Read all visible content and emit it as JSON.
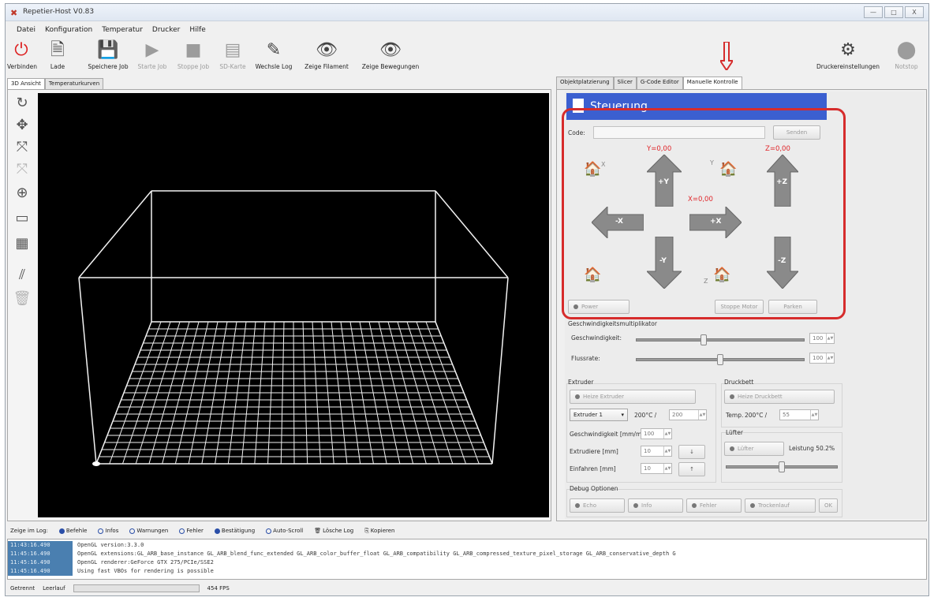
{
  "window": {
    "title": "Repetier-Host V0.83",
    "minimize": "—",
    "maximize": "□",
    "close": "X"
  },
  "menu": [
    "Datei",
    "Konfiguration",
    "Temperatur",
    "Drucker",
    "Hilfe"
  ],
  "toolbar": {
    "connect": "Verbinden",
    "load": "Lade",
    "save_job": "Speichere Job",
    "start_job": "Starte Job",
    "stop_job": "Stoppe Job",
    "sd_card": "SD-Karte",
    "toggle_log": "Wechsle Log",
    "show_filament": "Zeige Filament",
    "show_travel": "Zeige Bewegungen",
    "printer_settings": "Druckereinstellungen",
    "emergency_stop": "Notstop"
  },
  "left_tabs": [
    "3D Ansicht",
    "Temperaturkurven"
  ],
  "right_tabs": [
    "Objektplatzierung",
    "Slicer",
    "G-Code Editor",
    "Manuelle Kontrolle"
  ],
  "manual": {
    "header": "Steuerung",
    "code_label": "Code:",
    "code_value": "",
    "send": "Senden",
    "y_pos": "Y=0,00",
    "z_pos": "Z=0,00",
    "x_pos": "X=0,00",
    "plus_y": "+Y",
    "minus_y": "-Y",
    "plus_x": "+X",
    "minus_x": "-X",
    "plus_z": "+Z",
    "minus_z": "-Z",
    "axis_x": "X",
    "axis_y": "Y",
    "axis_z": "Z",
    "power": "Power",
    "stop_motor": "Stoppe Motor",
    "park": "Parken"
  },
  "speed": {
    "title": "Geschwindigkeitsmultiplikator",
    "speed_label": "Geschwindigkeit:",
    "speed_value": "100",
    "speed_level": 0.4,
    "flow_label": "Fluss­rate:",
    "flow_value": "100",
    "flow_level": 0.5
  },
  "extruder": {
    "title": "Extruder",
    "heat": "Heize Extruder",
    "select": "Extruder 1",
    "temp_text": "200°C /",
    "temp_target": "200",
    "speed_label": "Geschwindigkeit [mm/min]",
    "speed_value": "100",
    "extrude_label": "Extrudiere [mm]",
    "extrude_value": "10",
    "retract_label": "Einfahren [mm]",
    "retract_value": "10"
  },
  "bed": {
    "title": "Druckbett",
    "heat": "Heize Druckbett",
    "temp_label": "Temp.",
    "temp_text": "200°C /",
    "temp_target": "55"
  },
  "fan": {
    "title": "Lüfter",
    "button": "Lüfter",
    "power": "Leistung 50.2%",
    "level": 0.5
  },
  "debug": {
    "title": "Debug Optionen",
    "echo": "Echo",
    "info": "Info",
    "error": "Fehler",
    "dry_run": "Trockenlauf",
    "ok": "OK"
  },
  "log_filter": {
    "label": "Zeige im Log:",
    "commands": "Befehle",
    "infos": "Infos",
    "warnings": "Warnungen",
    "errors": "Fehler",
    "ack": "Bestätigung",
    "autoscroll": "Auto-Scroll",
    "clear": "Lösche Log",
    "copy": "Kopieren"
  },
  "log": [
    {
      "ts": "11:43:16.490",
      "msg": "OpenGL version:3.3.0"
    },
    {
      "ts": "11:45:16.490",
      "msg": "OpenGL extensions:GL_ARB_base_instance GL_ARB_blend_func_extended GL_ARB_color_buffer_float GL_ARB_compatibility GL_ARB_compressed_texture_pixel_storage GL_ARB_conservative_depth G"
    },
    {
      "ts": "11:45:16.490",
      "msg": "OpenGL renderer:GeForce GTX 275/PCIe/SSE2"
    },
    {
      "ts": "11:45:16.490",
      "msg": "Using fast VBOs for rendering is possible"
    }
  ],
  "status": {
    "state": "Getrennt",
    "idle": "Leerlauf",
    "fps": "454 FPS"
  },
  "colors": {
    "accent": "#3b5fd0",
    "highlight": "#d62c2c",
    "coord": "#e0262a"
  }
}
